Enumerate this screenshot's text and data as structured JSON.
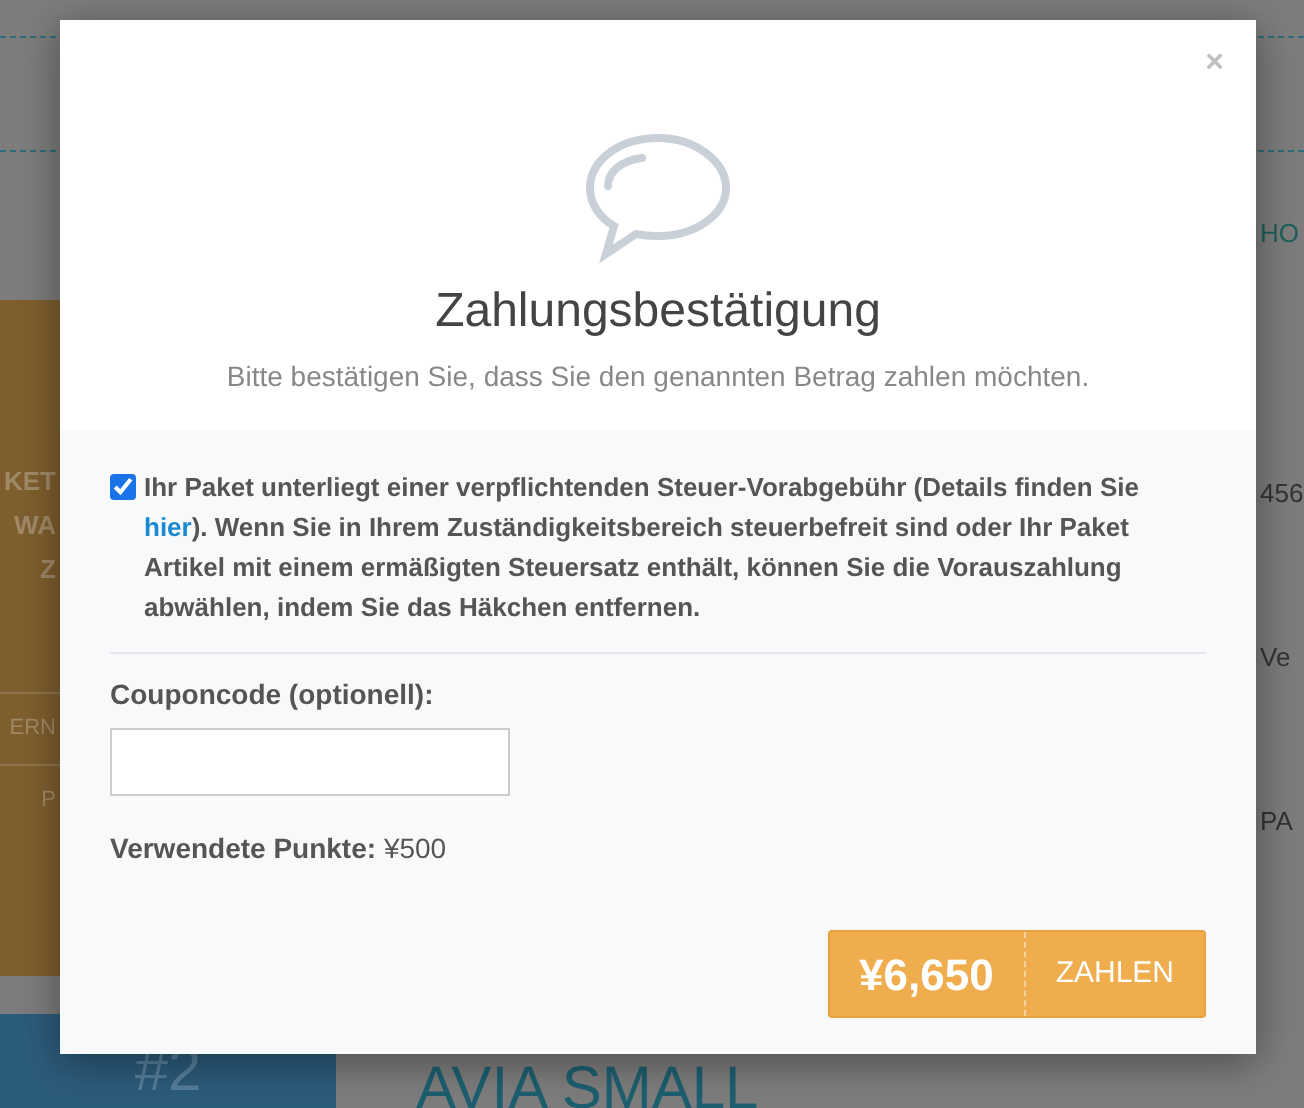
{
  "background": {
    "left_card": {
      "lines": [
        "KET",
        "WA",
        "Z"
      ],
      "buttons": [
        "ERN",
        "P"
      ]
    },
    "right_texts": [
      "HO",
      "456",
      "Ve",
      "PA"
    ],
    "bottom": {
      "badge": "#2",
      "title": "AVIA SMALL"
    }
  },
  "modal": {
    "close": "×",
    "title": "Zahlungsbestätigung",
    "subtitle": "Bitte bestätigen Sie, dass Sie den genannten Betrag zahlen möchten.",
    "tax_checkbox": {
      "checked": true,
      "text_before": "Ihr Paket unterliegt einer verpflichtenden Steuer-Vorabgebühr (Details finden Sie ",
      "link": "hier",
      "text_after": "). Wenn Sie in Ihrem Zuständigkeitsbereich steuerbefreit sind oder Ihr Paket Artikel mit einem ermäßigten Steuersatz enthält, können Sie die Vorauszahlung abwählen, indem Sie das Häkchen entfernen."
    },
    "coupon": {
      "label": "Couponcode (optionell):"
    },
    "points": {
      "label": "Verwendete Punkte:",
      "value": "¥500"
    },
    "pay_button": {
      "amount": "¥6,650",
      "label": "ZAHLEN"
    }
  }
}
